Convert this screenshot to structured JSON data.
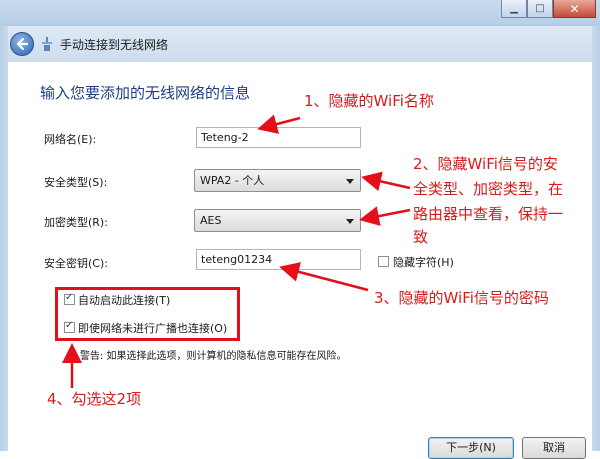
{
  "window": {
    "title": "手动连接到无线网络",
    "caption_buttons": [
      "minimize",
      "maximize",
      "close"
    ]
  },
  "heading": "输入您要添加的无线网络的信息",
  "form": {
    "network_name": {
      "label": "网络名(E):",
      "value": "Teteng-2"
    },
    "security_type": {
      "label": "安全类型(S):",
      "value": "WPA2 - 个人"
    },
    "encryption_type": {
      "label": "加密类型(R):",
      "value": "AES"
    },
    "security_key": {
      "label": "安全密钥(C):",
      "value": "teteng01234"
    },
    "hide_chars": {
      "label": "隐藏字符(H)",
      "checked": false
    }
  },
  "options": {
    "auto_start": {
      "label": "自动启动此连接(T)",
      "checked": true
    },
    "connect_hidden": {
      "label": "即使网络未进行广播也连接(O)",
      "checked": true
    }
  },
  "warning": "警告: 如果选择此选项，则计算机的隐私信息可能存在风险。",
  "buttons": {
    "next": "下一步(N)",
    "cancel": "取消"
  },
  "annotations": {
    "a1": "1、隐藏的WiFi名称",
    "a2_lines": [
      "2、隐藏WiFi信号的安",
      "全类型、加密类型，在",
      "路由器中查看，保持一",
      "致"
    ],
    "a3": "3、隐藏的WiFi信号的密码",
    "a4": "4、勾选这2项"
  },
  "colors": {
    "accent": "#e3101a",
    "heading": "#1e3f84"
  }
}
